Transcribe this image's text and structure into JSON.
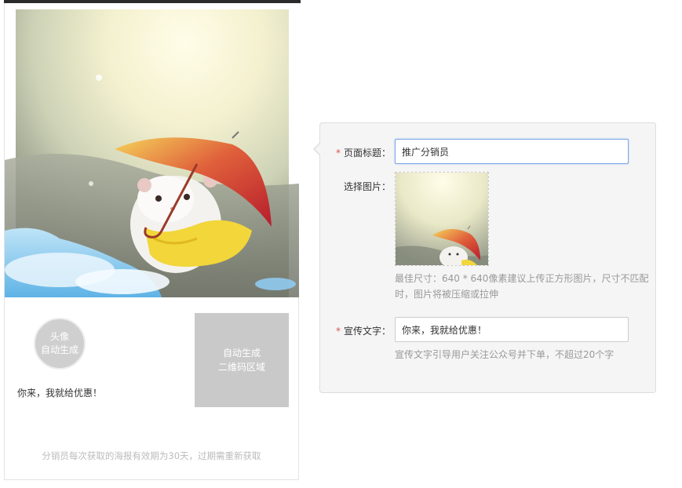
{
  "preview": {
    "avatar_line1": "头像",
    "avatar_line2": "自动生成",
    "promo_text": "你来，我就给优惠！",
    "qrcode_line1": "自动生成",
    "qrcode_line2": "二维码区域",
    "footer_note": "分销员每次获取的海报有效期为30天，过期需重新获取"
  },
  "form": {
    "page_title": {
      "required_mark": "*",
      "label": "页面标题：",
      "value": "推广分销员"
    },
    "image": {
      "label": "选择图片：",
      "hint": "最佳尺寸：640 * 640像素建议上传正方形图片，尺寸不匹配时，图片将被压缩或拉伸"
    },
    "promo_text": {
      "required_mark": "*",
      "label": "宣传文字：",
      "value": "你来，我就给优惠！",
      "hint": "宣传文字引导用户关注公众号并下单，不超过20个字"
    }
  },
  "colors": {
    "required": "#d9534f",
    "panel_bg": "#f5f5f5",
    "qrcode_placeholder": "#c9c9c9",
    "focus_border": "#7fa9e6"
  }
}
